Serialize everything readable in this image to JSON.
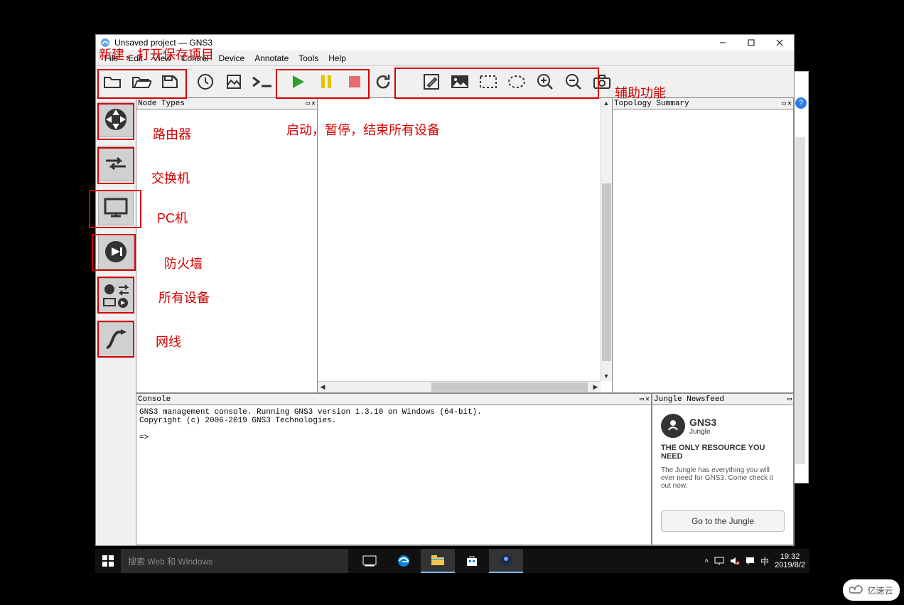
{
  "window": {
    "title": "Unsaved project — GNS3",
    "controls": {
      "minimize": "—",
      "maximize": "▢",
      "close": "✕"
    }
  },
  "menu": [
    "File",
    "Edit",
    "View",
    "Control",
    "Device",
    "Annotate",
    "Tools",
    "Help"
  ],
  "toolbar_icons": [
    "open-folder-icon",
    "open-folder2-icon",
    "save-icon",
    "recent-icon",
    "snapshot-icon",
    "console-icon",
    "play-icon",
    "pause-icon",
    "stop-icon",
    "reload-icon",
    "edit-icon",
    "image-icon",
    "rect-select-icon",
    "ellipse-select-icon",
    "zoom-in-icon",
    "zoom-out-icon",
    "camera-icon"
  ],
  "vtoolbar": [
    {
      "key": "router",
      "label": "路由器"
    },
    {
      "key": "switch",
      "label": "交换机"
    },
    {
      "key": "pc",
      "label": "PC机"
    },
    {
      "key": "firewall",
      "label": "防火墙"
    },
    {
      "key": "all",
      "label": "所有设备"
    },
    {
      "key": "link",
      "label": "网线"
    }
  ],
  "panels": {
    "nodetypes": "Node Types",
    "topology": "Topology Summary",
    "console": "Console",
    "jungle": "Jungle Newsfeed"
  },
  "console_text": "GNS3 management console. Running GNS3 version 1.3.10 on Windows (64-bit).\nCopyright (c) 2006-2019 GNS3 Technologies.\n\n=> ",
  "jungle": {
    "brand_line1": "GNS3",
    "brand_line2": "Jungle",
    "headline": "THE ONLY RESOURCE YOU NEED",
    "body": "The Jungle has everything you will ever need for GNS3. Come check it out now.",
    "button": "Go to the Jungle"
  },
  "annotations": {
    "project_ops": "新建，打开保存项目",
    "run_controls": "启动，暂停，结束所有设备",
    "aux_tools": "辅助功能"
  },
  "taskbar": {
    "search_placeholder": "搜索 Web 和 Windows",
    "tray": {
      "ime": "中",
      "time": "19:32",
      "date": "2019/8/2"
    }
  },
  "watermark": "亿速云",
  "colors": {
    "red": "#d40000",
    "play": "#2ca02c",
    "pause": "#e6c100",
    "stop": "#e84d4d"
  }
}
